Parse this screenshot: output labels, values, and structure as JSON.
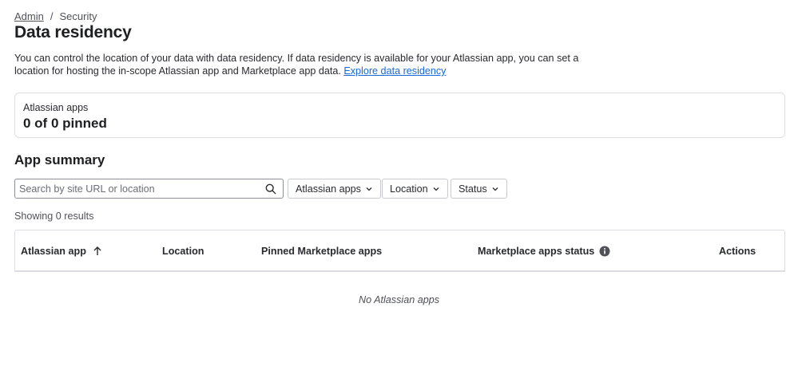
{
  "breadcrumb": {
    "root": "Admin",
    "separator": "/",
    "current": "Security"
  },
  "page": {
    "title": "Data residency",
    "description": "You can control the location of your data with data residency. If data residency is available for your Atlassian app, you can set a location for hosting the in-scope Atlassian app and Marketplace app data. ",
    "description_link": "Explore data residency"
  },
  "stat_card": {
    "label": "Atlassian apps",
    "value": "0 of 0 pinned"
  },
  "summary": {
    "title": "App summary",
    "search_placeholder": "Search by site URL or location",
    "filters": {
      "apps": "Atlassian apps",
      "location": "Location",
      "status": "Status"
    },
    "results": "Showing 0 results"
  },
  "table": {
    "columns": {
      "app": "Atlassian app",
      "location": "Location",
      "pinned": "Pinned Marketplace apps",
      "status": "Marketplace apps status",
      "actions": "Actions"
    },
    "empty": "No Atlassian apps"
  },
  "colors": {
    "link": "#1868db",
    "border": "#dddee1",
    "text": "#292a2e"
  },
  "icons": [
    "search-icon",
    "chevron-down-icon",
    "arrow-up-icon",
    "info-icon"
  ]
}
